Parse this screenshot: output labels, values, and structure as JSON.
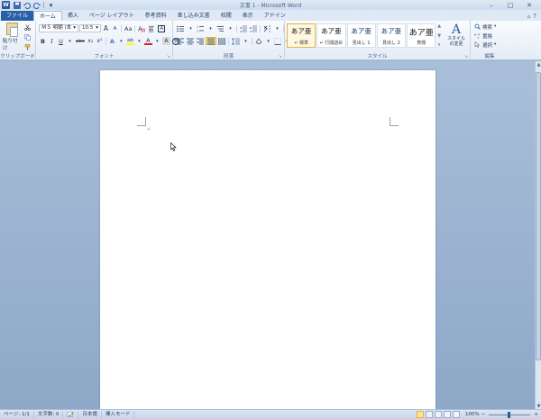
{
  "window": {
    "title": "文書 1 - Microsoft Word",
    "app_icon": "W",
    "controls": {
      "minimize": "–",
      "maximize": "□",
      "close": "✕"
    }
  },
  "quick_access": {
    "save_icon": "💾",
    "undo_icon": "↶",
    "redo_icon": "↻",
    "customize_icon": "▾"
  },
  "tabs": [
    {
      "label": "ファイル",
      "kind": "file"
    },
    {
      "label": "ホーム",
      "kind": "active"
    },
    {
      "label": "挿入"
    },
    {
      "label": "ページ レイアウト"
    },
    {
      "label": "参考資料"
    },
    {
      "label": "差し込み文書"
    },
    {
      "label": "校閲"
    },
    {
      "label": "表示"
    },
    {
      "label": "アドイン"
    }
  ],
  "tab_right": {
    "minimize_ribbon": "▵",
    "help": "?"
  },
  "groups": {
    "clipboard": {
      "label": "クリップボード",
      "paste": "貼り付け"
    },
    "font": {
      "label": "フォント",
      "font_name": "ＭＳ 明朝 (本",
      "font_size": "10.5",
      "grow": "A",
      "shrink": "A",
      "change_case": "Aa",
      "bold": "B",
      "italic": "I",
      "underline": "U",
      "strike": "abc",
      "subscript": "x₂",
      "superscript": "x²",
      "text_effects": "A",
      "highlight": "ab",
      "font_color": "A",
      "char_border": "A",
      "enclose": "字"
    },
    "paragraph": {
      "label": "段落"
    },
    "styles": {
      "label": "スタイル",
      "items": [
        {
          "preview": "あア亜",
          "name": "↵ 標準"
        },
        {
          "preview": "あア亜",
          "name": "↵ 行間詰め"
        },
        {
          "preview": "あア亜",
          "name": "見出し 1"
        },
        {
          "preview": "あア亜",
          "name": "見出し 2"
        },
        {
          "preview": "あア亜",
          "name": "表題"
        }
      ],
      "change_styles_label": "スタイルの変更"
    },
    "editing": {
      "label": "編集",
      "find": "検索",
      "replace": "置換",
      "select": "選択"
    }
  },
  "document": {
    "paragraph_mark": "↵"
  },
  "status": {
    "page": "ページ: 1/1",
    "words": "文字数: 0",
    "language": "日本語",
    "mode": "挿入モード",
    "zoom": "100%",
    "zoom_minus": "−",
    "zoom_plus": "+"
  },
  "colors": {
    "file_tab": "#2a5ea5",
    "highlight_yellow": "#ffff00",
    "font_red": "#e02020",
    "active_yellow": "#fce38c"
  }
}
